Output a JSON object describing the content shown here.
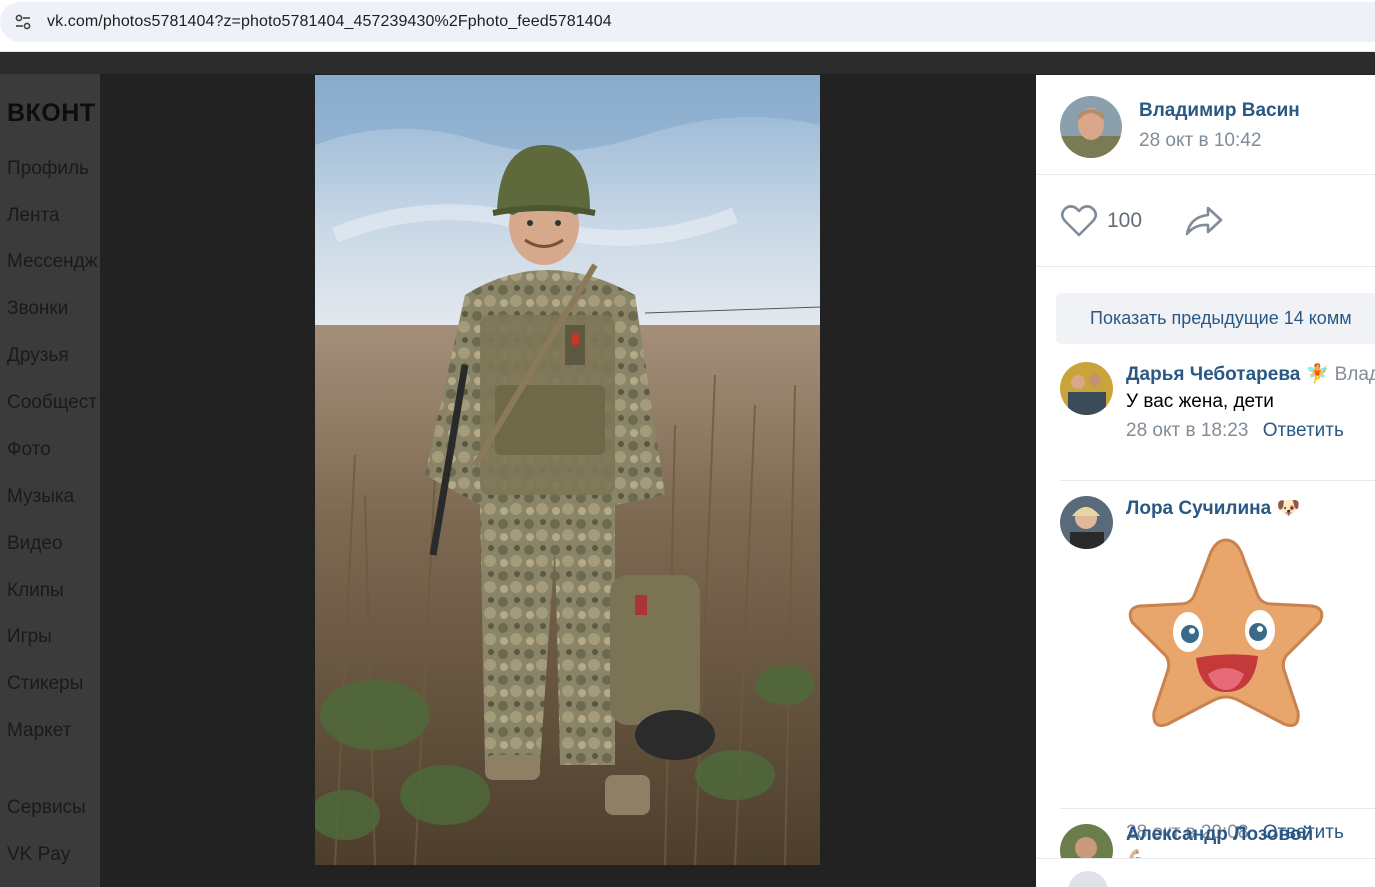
{
  "browser": {
    "url": "vk.com/photos5781404?z=photo5781404_457239430%2Fphoto_feed5781404",
    "site_icon": "tune-icon"
  },
  "vk": {
    "logo_text": "ВКОНТ",
    "menu": [
      "Профиль",
      "Лента",
      "Мессендж",
      "Звонки",
      "Друзья",
      "Сообщест",
      "Фото",
      "Музыка",
      "Видео",
      "Клипы",
      "Игры",
      "Стикеры",
      "Маркет"
    ],
    "menu_secondary": [
      "Сервисы",
      "VK Pay"
    ]
  },
  "viewer": {
    "author": {
      "name": "Владимир Васин",
      "date": "28 окт в 10:42"
    },
    "likes": "100",
    "like_icon": "heart-icon",
    "share_icon": "share-arrow-icon",
    "show_previous": "Показать предыдущие 14 комм",
    "comments": [
      {
        "name": "Дарья Чеботарева",
        "emoji": "🧚",
        "reply_to": "Влад",
        "text": "У вас жена, дети",
        "date": "28 окт в 18:23",
        "reply": "Ответить"
      },
      {
        "name": "Лора Сучилина",
        "emoji": "🐶",
        "sticker": "star-smile-sticker",
        "date": "28 окт в 20:08",
        "reply": "Ответить"
      },
      {
        "name": "Александр Лозовой",
        "emoji": "💪🏼"
      }
    ]
  },
  "colors": {
    "link": "#2a5885",
    "muted": "#818c99",
    "overlay": "#222222"
  }
}
